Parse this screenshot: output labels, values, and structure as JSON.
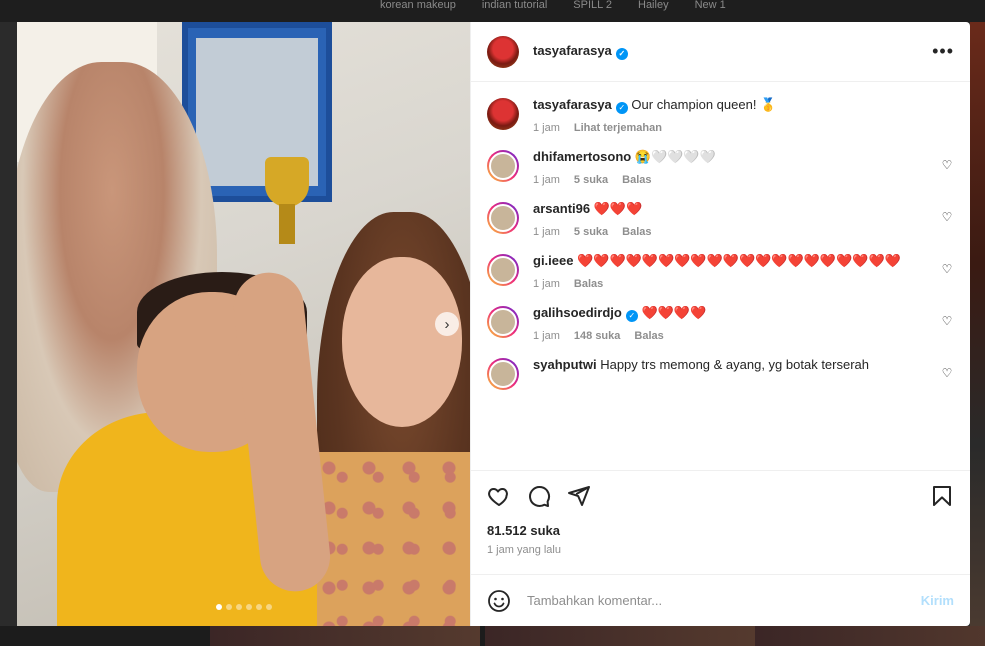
{
  "background": {
    "tabs": [
      "korean makeup",
      "indian tutorial",
      "SPILL 2",
      "Hailey",
      "New 1"
    ]
  },
  "media": {
    "carousel": {
      "total": 6,
      "current": 1
    },
    "next_icon": "chevron-right-icon"
  },
  "post": {
    "author": "tasyafarasya",
    "verified": true,
    "more_icon": "more-horizontal-icon"
  },
  "comments": [
    {
      "user": "tasyafarasya",
      "verified": true,
      "text": "Our champion queen! 🥇",
      "time": "1 jam",
      "likes": "",
      "action": "Lihat terjemahan",
      "has_like": false
    },
    {
      "user": "dhifamertosono",
      "verified": false,
      "text": "😭🤍🤍🤍🤍",
      "time": "1 jam",
      "likes": "5 suka",
      "action": "Balas",
      "has_like": true
    },
    {
      "user": "arsanti96",
      "verified": false,
      "text": "❤️❤️❤️",
      "time": "1 jam",
      "likes": "5 suka",
      "action": "Balas",
      "has_like": true
    },
    {
      "user": "gi.ieee",
      "verified": false,
      "text": "❤️❤️❤️❤️❤️❤️❤️❤️❤️❤️❤️❤️❤️❤️❤️❤️❤️❤️❤️❤️",
      "time": "1 jam",
      "likes": "",
      "action": "Balas",
      "has_like": true
    },
    {
      "user": "galihsoedirdjo",
      "verified": true,
      "text": "❤️❤️❤️❤️",
      "time": "1 jam",
      "likes": "148 suka",
      "action": "Balas",
      "has_like": true
    },
    {
      "user": "syahputwi",
      "verified": false,
      "text": "Happy trs memong & ayang, yg botak terserah",
      "time": "",
      "likes": "",
      "action": "",
      "has_like": true
    }
  ],
  "footer": {
    "likes_count": "81.512 suka",
    "posted_time": "1 jam yang lalu",
    "comment_placeholder": "Tambahkan komentar...",
    "post_button": "Kirim"
  },
  "colors": {
    "accent": "#0095f6",
    "post_disabled": "#b2dffc",
    "heart": "#e0245e"
  }
}
